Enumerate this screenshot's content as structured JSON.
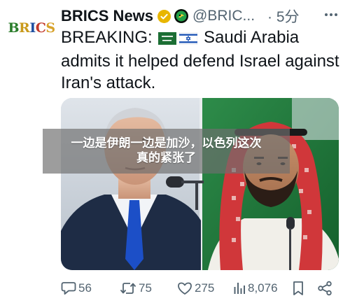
{
  "tweet": {
    "author_name": "BRICS News",
    "avatar_text": "BRICS",
    "handle": "@BRIC...",
    "time": "· 5分",
    "text_prefix": "BREAKING: ",
    "text_after_flags": " Saudi Arabia admits it helped defend Israel against Iran's attack.",
    "flags": [
      "saudi-arabia-flag",
      "israel-flag"
    ]
  },
  "overlay": {
    "line1": "一边是伊朗一边是加沙，以色列这次",
    "line2": "真的紧张了"
  },
  "stats": {
    "replies": "56",
    "reposts": "75",
    "likes": "275",
    "views": "8,076"
  },
  "icons": {
    "verified": "verified-badge-icon",
    "affiliate": "affiliate-badge-icon",
    "reply": "reply-icon",
    "repost": "repost-icon",
    "like": "heart-icon",
    "views": "views-bars-icon",
    "bookmark": "bookmark-icon",
    "share": "share-icon",
    "more": "more-dots-icon"
  },
  "colors": {
    "text_primary": "#0f1419",
    "text_secondary": "#536471",
    "verified_gold": "#e8b600",
    "affiliate_green": "#1f8f3a",
    "overlay_bg": "rgba(110,110,110,0.68)"
  }
}
